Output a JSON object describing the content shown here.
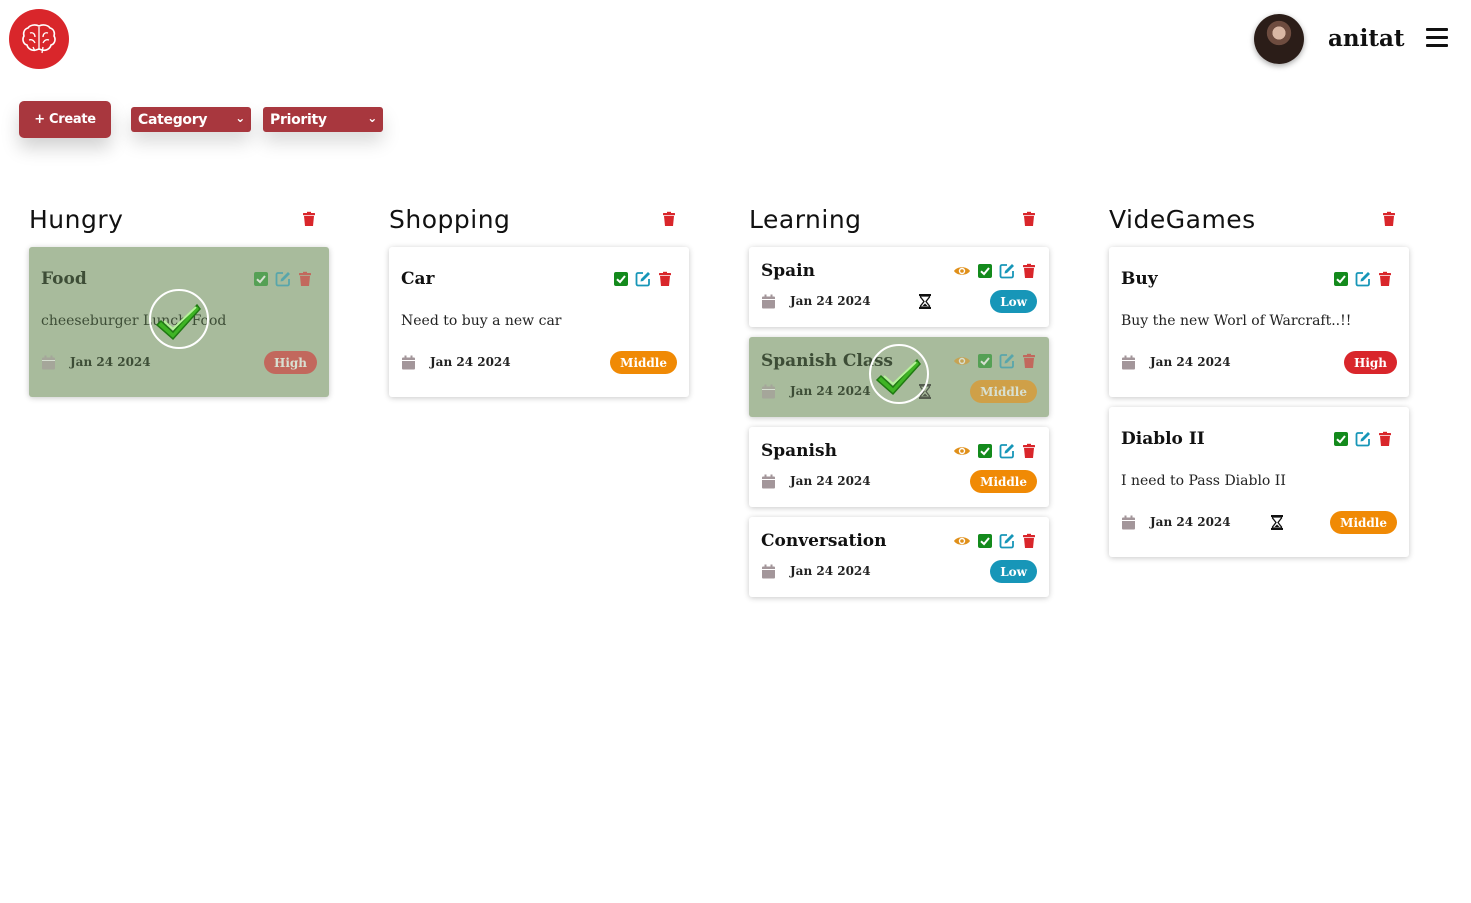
{
  "header": {
    "username": "anitat"
  },
  "toolbar": {
    "create_label": "+ Create",
    "category_label": "Category",
    "priority_label": "Priority"
  },
  "colors": {
    "accent": "#a8373e",
    "logo": "#d9262b",
    "done_card": "#a8bb9c",
    "high": "#d9262b",
    "middle": "#f08a05",
    "low": "#1796b8",
    "check": "#138a1c",
    "edit": "#1796b8",
    "delete": "#d9262b",
    "view": "#e0901a"
  },
  "columns": [
    {
      "title": "Hungry",
      "cards": [
        {
          "title": "Food",
          "description": "cheeseburger Lunch Food",
          "date": "Jan 24 2024",
          "priority": "High",
          "completed": true
        }
      ]
    },
    {
      "title": "Shopping",
      "cards": [
        {
          "title": "Car",
          "description": "Need to buy a new car",
          "date": "Jan 24 2024",
          "priority": "Middle",
          "completed": false
        }
      ]
    },
    {
      "title": "Learning",
      "cards": [
        {
          "title": "Spain",
          "date": "Jan 24 2024",
          "priority": "Low",
          "completed": false
        },
        {
          "title": "Spanish Class",
          "date": "Jan 24 2024",
          "priority": "Middle",
          "completed": true
        },
        {
          "title": "Spanish",
          "date": "Jan 24 2024",
          "priority": "Middle",
          "completed": false
        },
        {
          "title": "Conversation",
          "date": "Jan 24 2024",
          "priority": "Low",
          "completed": false
        }
      ]
    },
    {
      "title": "VideGames",
      "cards": [
        {
          "title": "Buy",
          "description": "Buy the new Worl of Warcraft..!!",
          "date": "Jan 24 2024",
          "priority": "High",
          "completed": false
        },
        {
          "title": "Diablo II",
          "description": "I need to Pass Diablo II",
          "date": "Jan 24 2024",
          "priority": "Middle",
          "completed": false
        }
      ]
    }
  ]
}
